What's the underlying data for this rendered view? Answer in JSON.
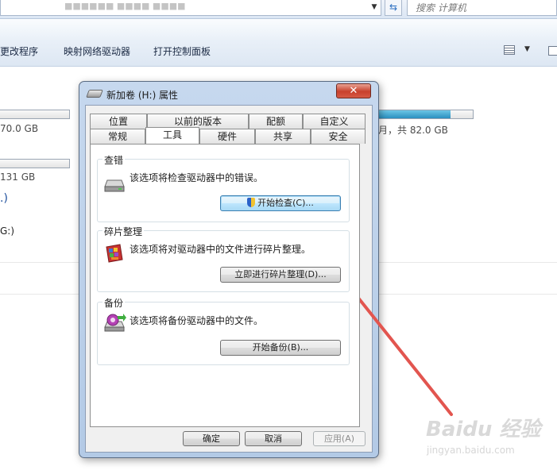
{
  "explorer": {
    "address_ghost": "■■■■■■ ■■■■ ■■■■",
    "search_placeholder": "搜索 计算机",
    "toolbar": {
      "uninstall_label": "更改程序",
      "map_drive_label": "映射网络驱动器",
      "control_panel_label": "打开控制面板"
    },
    "drives": [
      {
        "size_text": "70.0 GB",
        "fill": 0.0
      },
      {
        "size_text": "131 GB",
        "fill": 0.0
      },
      {
        "size_text": "月，共 82.0 GB",
        "fill": 0.76
      }
    ],
    "group_tail": ".)",
    "drive_g_label": "G:)"
  },
  "dialog": {
    "title": "新加卷 (H:) 属性",
    "close_glyph": "✕",
    "tabs_row1": [
      "位置",
      "以前的版本",
      "配额",
      "自定义"
    ],
    "tabs_row2": [
      "常规",
      "工具",
      "硬件",
      "共享",
      "安全"
    ],
    "active_tab": "工具",
    "groups": {
      "error_check": {
        "title": "查错",
        "description": "该选项将检查驱动器中的错误。",
        "button": "开始检查(C)..."
      },
      "defrag": {
        "title": "碎片整理",
        "description": "该选项将对驱动器中的文件进行碎片整理。",
        "button": "立即进行碎片整理(D)..."
      },
      "backup": {
        "title": "备份",
        "description": "该选项将备份驱动器中的文件。",
        "button": "开始备份(B)..."
      }
    },
    "buttons": {
      "ok": "确定",
      "cancel": "取消",
      "apply": "应用(A)"
    }
  },
  "watermark": {
    "logo": "Baidu 经验",
    "url": "jingyan.baidu.com"
  },
  "colors": {
    "annotation_arrow": "#e2554f",
    "dialog_frame": "#b9cee9",
    "close_button": "#c8402c",
    "drive_fill": "#2a8fbf"
  }
}
